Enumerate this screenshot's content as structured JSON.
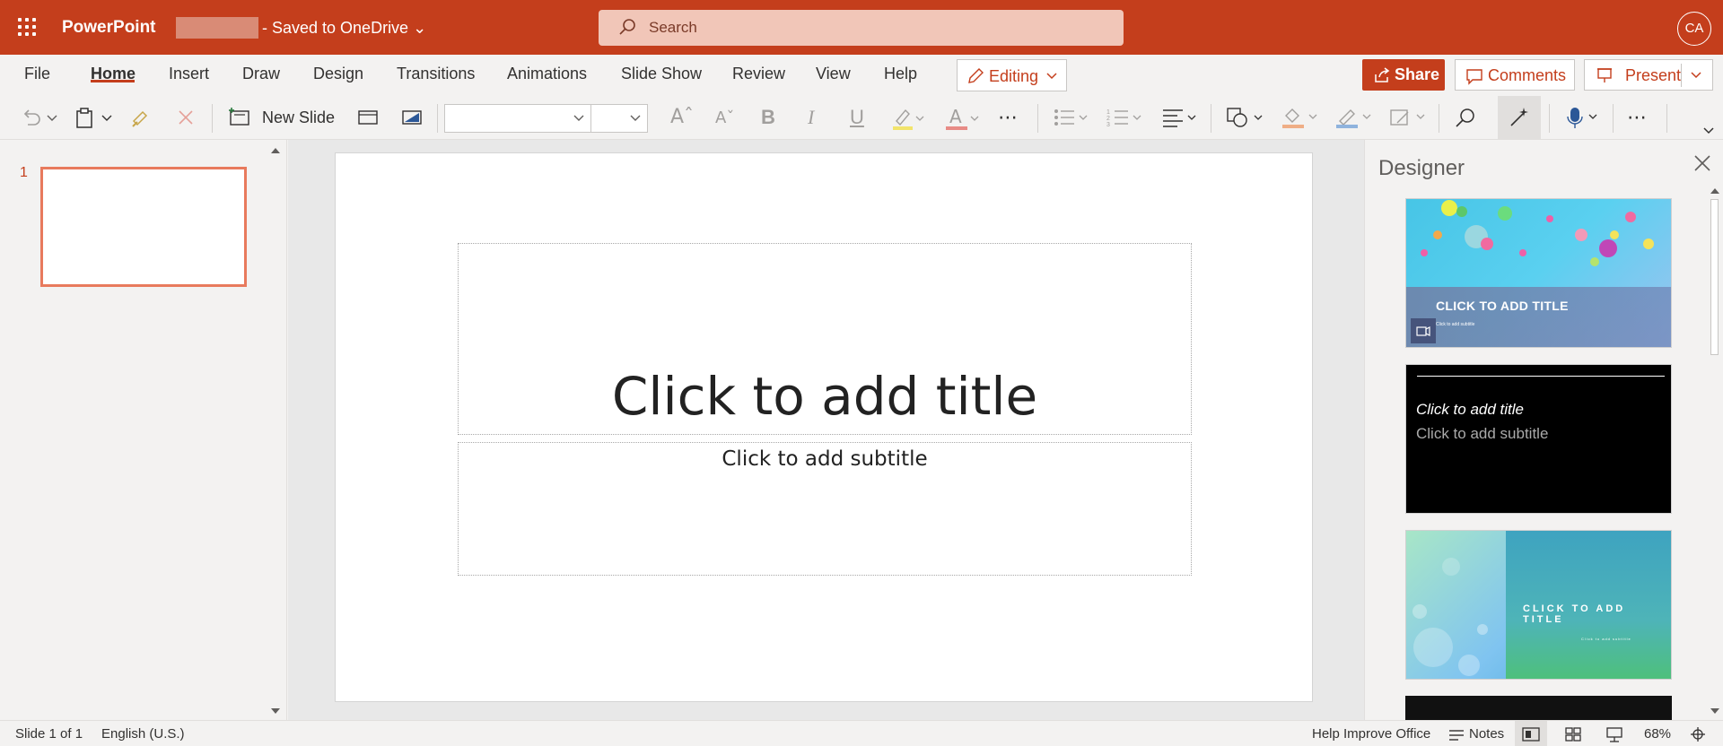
{
  "titlebar": {
    "app_name": "PowerPoint",
    "doc_status": "- Saved to OneDrive ⌄",
    "search_placeholder": "Search",
    "avatar_initials": "CA",
    "accent_color": "#c43e1c"
  },
  "ribbon": {
    "tabs": [
      "File",
      "Home",
      "Insert",
      "Draw",
      "Design",
      "Transitions",
      "Animations",
      "Slide Show",
      "Review",
      "View",
      "Help"
    ],
    "active_tab": "Home",
    "editing_label": "Editing",
    "share_label": "Share",
    "comments_label": "Comments",
    "present_label": "Present",
    "new_slide_label": "New Slide",
    "font_name": "",
    "font_size": ""
  },
  "thumbnails": {
    "slide_number": "1"
  },
  "slide": {
    "title_placeholder": "Click to add title",
    "subtitle_placeholder": "Click to add subtitle"
  },
  "designer": {
    "title": "Designer",
    "card1_title": "CLICK TO ADD TITLE",
    "card1_subtitle": "Click to add subtitle",
    "card2_title": "Click to add title",
    "card2_subtitle": "Click to add subtitle",
    "card3_title": "CLICK TO ADD TITLE",
    "card3_subtitle": "Click to add subtitle"
  },
  "statusbar": {
    "slide_info": "Slide 1 of 1",
    "language": "English (U.S.)",
    "help_improve": "Help Improve Office",
    "notes_label": "Notes",
    "zoom": "68%"
  }
}
